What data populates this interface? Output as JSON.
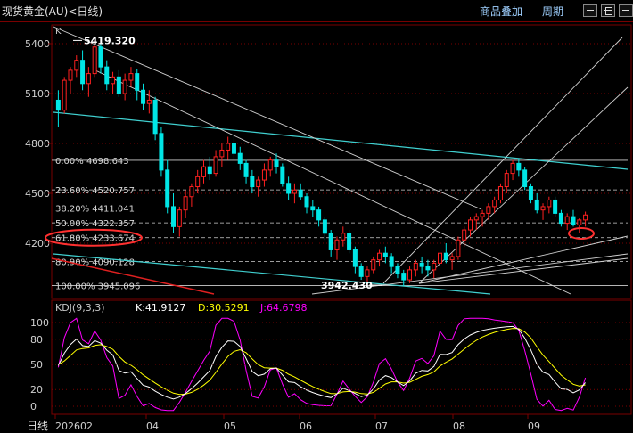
{
  "window": {
    "title": "现货黄金(AU)<日线)",
    "toolbar_overlay_label": "商品叠加",
    "toolbar_period_label": "周期"
  },
  "main_chart": {
    "corner_mark": "K",
    "high_marker": "5419.320",
    "low_marker": "3942.430",
    "y_ticks": [
      "5400",
      "5100",
      "4800",
      "4500",
      "4200"
    ],
    "fib_levels": [
      {
        "label": "0.00%",
        "price": 4698.643,
        "text": "4698.643"
      },
      {
        "label": "23.60%",
        "price": 4520.757,
        "text": "4520.757"
      },
      {
        "label": "38.20%",
        "price": 4411.041,
        "text": "4411.041"
      },
      {
        "label": "50.00%",
        "price": 4322.357,
        "text": "4322.357"
      },
      {
        "label": "61.80%",
        "price": 4233.674,
        "text": "4233.674"
      },
      {
        "label": "80.90%",
        "price": 4090.128,
        "text": "4090.128"
      },
      {
        "label": "100.00%",
        "price": 3945.096,
        "text": "3945.096"
      }
    ],
    "ohlc": [
      [
        5060,
        5120,
        4900,
        5000
      ],
      [
        5000,
        5200,
        4980,
        5180
      ],
      [
        5180,
        5260,
        5100,
        5240
      ],
      [
        5240,
        5330,
        5200,
        5300
      ],
      [
        5300,
        5360,
        5120,
        5160
      ],
      [
        5160,
        5260,
        5080,
        5220
      ],
      [
        5220,
        5420,
        5200,
        5380
      ],
      [
        5380,
        5419,
        5220,
        5260
      ],
      [
        5260,
        5300,
        5120,
        5160
      ],
      [
        5160,
        5230,
        5100,
        5200
      ],
      [
        5200,
        5240,
        5080,
        5100
      ],
      [
        5100,
        5220,
        5060,
        5180
      ],
      [
        5180,
        5260,
        5140,
        5220
      ],
      [
        5220,
        5250,
        5060,
        5120
      ],
      [
        5120,
        5160,
        5000,
        5040
      ],
      [
        5040,
        5120,
        4980,
        5060
      ],
      [
        5060,
        5080,
        4820,
        4860
      ],
      [
        4860,
        4900,
        4600,
        4640
      ],
      [
        4640,
        4700,
        4380,
        4420
      ],
      [
        4420,
        4500,
        4260,
        4300
      ],
      [
        4300,
        4420,
        4240,
        4400
      ],
      [
        4400,
        4520,
        4350,
        4480
      ],
      [
        4480,
        4560,
        4420,
        4540
      ],
      [
        4540,
        4640,
        4500,
        4600
      ],
      [
        4600,
        4700,
        4560,
        4660
      ],
      [
        4660,
        4720,
        4580,
        4620
      ],
      [
        4620,
        4760,
        4600,
        4720
      ],
      [
        4720,
        4800,
        4660,
        4760
      ],
      [
        4760,
        4840,
        4700,
        4800
      ],
      [
        4800,
        4860,
        4700,
        4740
      ],
      [
        4740,
        4780,
        4640,
        4680
      ],
      [
        4680,
        4700,
        4560,
        4600
      ],
      [
        4600,
        4640,
        4500,
        4540
      ],
      [
        4540,
        4600,
        4480,
        4580
      ],
      [
        4580,
        4680,
        4540,
        4640
      ],
      [
        4640,
        4720,
        4600,
        4700
      ],
      [
        4700,
        4740,
        4620,
        4660
      ],
      [
        4660,
        4680,
        4540,
        4560
      ],
      [
        4560,
        4600,
        4460,
        4500
      ],
      [
        4500,
        4560,
        4440,
        4520
      ],
      [
        4520,
        4560,
        4460,
        4480
      ],
      [
        4480,
        4500,
        4380,
        4420
      ],
      [
        4420,
        4460,
        4360,
        4400
      ],
      [
        4400,
        4420,
        4300,
        4340
      ],
      [
        4340,
        4360,
        4220,
        4260
      ],
      [
        4260,
        4280,
        4120,
        4160
      ],
      [
        4160,
        4240,
        4100,
        4220
      ],
      [
        4220,
        4300,
        4180,
        4260
      ],
      [
        4260,
        4280,
        4140,
        4160
      ],
      [
        4160,
        4180,
        4020,
        4060
      ],
      [
        4060,
        4080,
        3980,
        4000
      ],
      [
        4000,
        4060,
        3960,
        4040
      ],
      [
        4040,
        4120,
        4020,
        4100
      ],
      [
        4100,
        4160,
        4060,
        4140
      ],
      [
        4140,
        4180,
        4080,
        4120
      ],
      [
        4120,
        4140,
        4020,
        4060
      ],
      [
        4060,
        4080,
        3990,
        4020
      ],
      [
        4020,
        4040,
        3942,
        3980
      ],
      [
        3980,
        4060,
        3960,
        4040
      ],
      [
        4040,
        4100,
        4000,
        4080
      ],
      [
        4080,
        4120,
        4020,
        4060
      ],
      [
        4060,
        4100,
        4000,
        4040
      ],
      [
        4040,
        4100,
        3990,
        4080
      ],
      [
        4080,
        4160,
        4060,
        4140
      ],
      [
        4140,
        4200,
        4080,
        4100
      ],
      [
        4100,
        4140,
        4040,
        4120
      ],
      [
        4120,
        4240,
        4100,
        4220
      ],
      [
        4220,
        4300,
        4180,
        4280
      ],
      [
        4280,
        4360,
        4240,
        4340
      ],
      [
        4340,
        4380,
        4280,
        4360
      ],
      [
        4360,
        4400,
        4300,
        4380
      ],
      [
        4380,
        4440,
        4340,
        4420
      ],
      [
        4420,
        4480,
        4380,
        4460
      ],
      [
        4460,
        4560,
        4440,
        4540
      ],
      [
        4540,
        4640,
        4500,
        4620
      ],
      [
        4620,
        4700,
        4580,
        4680
      ],
      [
        4680,
        4710,
        4600,
        4640
      ],
      [
        4640,
        4660,
        4520,
        4540
      ],
      [
        4540,
        4560,
        4440,
        4460
      ],
      [
        4460,
        4500,
        4380,
        4400
      ],
      [
        4400,
        4440,
        4340,
        4420
      ],
      [
        4420,
        4480,
        4380,
        4460
      ],
      [
        4460,
        4480,
        4360,
        4380
      ],
      [
        4380,
        4400,
        4300,
        4320
      ],
      [
        4320,
        4380,
        4280,
        4360
      ],
      [
        4360,
        4400,
        4300,
        4310
      ],
      [
        4310,
        4350,
        4260,
        4340
      ],
      [
        4340,
        4390,
        4300,
        4370
      ]
    ]
  },
  "kdj": {
    "header": "KDJ(9,3,3)",
    "k_text": "K:41.9127",
    "d_text": "D:30.5291",
    "j_text": "J:64.6798",
    "y_ticks": [
      "100",
      "80",
      "50",
      "20",
      "0"
    ]
  },
  "x_axis": {
    "left_label": "日线",
    "ticks": [
      "202602",
      "04",
      "05",
      "06",
      "07",
      "08",
      "09"
    ]
  },
  "colors": {
    "background": "#000000",
    "axis_red": "#7a0000",
    "up_candle": "#ff2020",
    "down_candle": "#00e6e6",
    "grid_dash": "#7a0000",
    "channel_cyan": "#40d0d0",
    "trendline_white": "#d0d0d0",
    "k_line": "#ffffff",
    "d_line": "#ffff00",
    "j_line": "#ff00ff",
    "highlight_ellipse": "#ff3030"
  }
}
